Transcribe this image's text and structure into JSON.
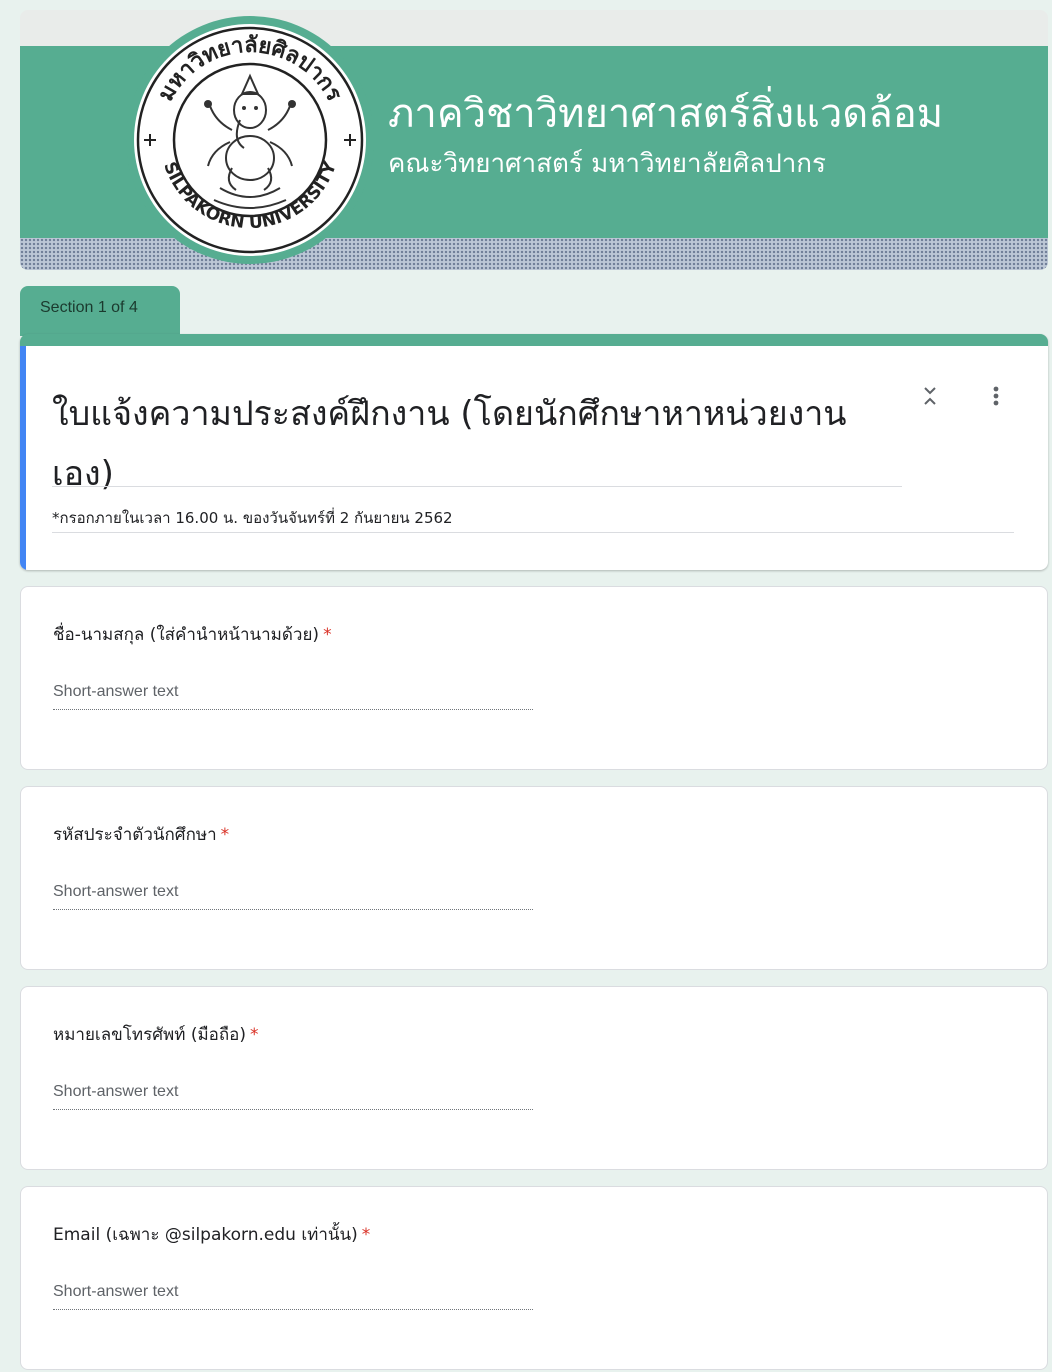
{
  "header": {
    "title": "ภาควิชาวิทยาศาสตร์สิ่งแวดล้อม",
    "subtitle": "คณะวิทยาศาสตร์ มหาวิทยาลัยศิลปากร",
    "seal_top_text": "มหาวิทยาลัยศิลปากร",
    "seal_bottom_text": "SILPAKORN UNIVERSITY",
    "logo_icon": "university-seal-icon",
    "colors": {
      "theme": "#56ad91",
      "accent_bar": "#4285f4",
      "required": "#d93025"
    }
  },
  "section": {
    "label": "Section 1 of 4"
  },
  "form": {
    "title": "ใบแจ้งความประสงค์ฝึกงาน (โดยนักศึกษาหาหน่วยงานเอง)",
    "description": "*กรอกภายในเวลา 16.00 น. ของวันจันทร์ที่ 2 กันยายน 2562",
    "collapse_icon": "collapse-section-icon",
    "more_icon": "more-vert-icon"
  },
  "questions": [
    {
      "label": "ชื่อ-นามสกุล (ใส่คำนำหน้านามด้วย)",
      "required_mark": "*",
      "answer_placeholder": "Short-answer text"
    },
    {
      "label": "รหัสประจำตัวนักศึกษา",
      "required_mark": "*",
      "answer_placeholder": "Short-answer text"
    },
    {
      "label": "หมายเลขโทรศัพท์ (มือถือ)",
      "required_mark": "*",
      "answer_placeholder": "Short-answer text"
    },
    {
      "label": "Email (เฉพาะ @silpakorn.edu เท่านั้น)",
      "required_mark": "*",
      "answer_placeholder": "Short-answer text"
    }
  ]
}
